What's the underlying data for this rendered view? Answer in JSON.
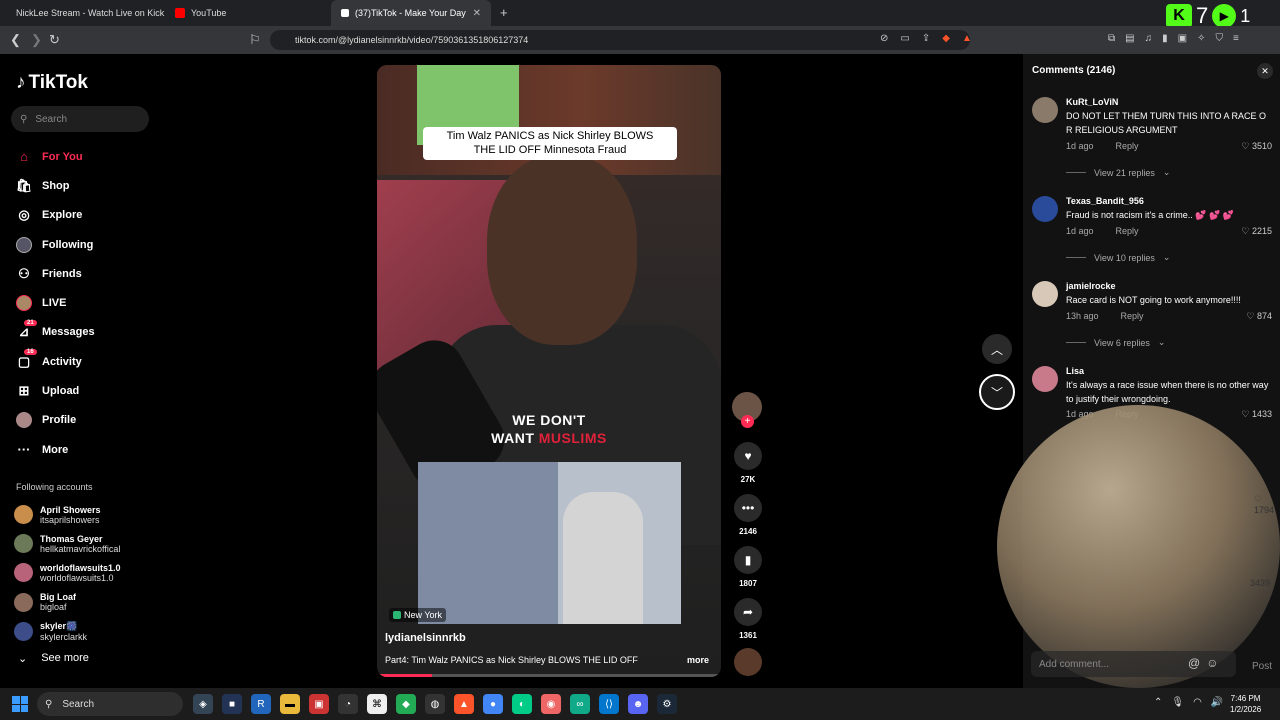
{
  "browser": {
    "tabs": [
      {
        "title": "NickLee Stream - Watch Live on Kick",
        "icon_color": "#53fc18"
      },
      {
        "title": "YouTube",
        "icon_color": "#ff0000"
      },
      {
        "title": "(37)TikTok - Make Your Day",
        "icon_color": "#ffffff"
      }
    ],
    "url": "tiktok.com/@lydianelsinnrkb/video/7590361351806127374",
    "kick_letter": "K",
    "kick_count": "7",
    "play_count": "1"
  },
  "sidebar": {
    "logo": "TikTok",
    "search_placeholder": "Search",
    "items": [
      {
        "label": "For You",
        "icon": "home-icon"
      },
      {
        "label": "Shop",
        "icon": "shop-icon"
      },
      {
        "label": "Explore",
        "icon": "compass-icon"
      },
      {
        "label": "Following",
        "icon": "following-icon"
      },
      {
        "label": "Friends",
        "icon": "friends-icon"
      },
      {
        "label": "LIVE",
        "icon": "live-icon"
      },
      {
        "label": "Messages",
        "icon": "message-icon",
        "badge": "21"
      },
      {
        "label": "Activity",
        "icon": "activity-icon",
        "badge": "16"
      },
      {
        "label": "Upload",
        "icon": "upload-icon"
      },
      {
        "label": "Profile",
        "icon": "profile-icon"
      },
      {
        "label": "More",
        "icon": "more-icon"
      }
    ],
    "following_title": "Following accounts",
    "following": [
      {
        "name": "April Showers",
        "handle": "itsaprilshowers",
        "color": "#c98e4b"
      },
      {
        "name": "Thomas Geyer",
        "handle": "hellkatmavrickoffical",
        "color": "#6d7a5a"
      },
      {
        "name": "worldoflawsuits1.0",
        "handle": "worldoflawsuits1.0",
        "color": "#b8637a"
      },
      {
        "name": "Big Loaf",
        "handle": "bigloaf",
        "color": "#8a6a5a"
      },
      {
        "name": "skyler🎆",
        "handle": "skylerclarkk",
        "color": "#3c4d8a"
      }
    ],
    "see_more": "See more"
  },
  "video": {
    "caption_line1": "Tim Walz PANICS as Nick Shirley BLOWS",
    "caption_line2": "THE LID OFF Minnesota Fraud",
    "overlay_white1": "WE DON'T",
    "overlay_white2": "WANT",
    "overlay_red": "MUSLIMS",
    "location": "New York",
    "username": "lydianelsinnrkb",
    "description": "Part4: Tim Walz PANICS as Nick Shirley BLOWS THE LID OFF",
    "more_label": "more",
    "progress": 0.16,
    "likes": "27K",
    "comments": "2146",
    "saves": "1807",
    "shares": "1361"
  },
  "comments_panel": {
    "title": "Comments (2146)",
    "reply_label": "Reply",
    "comments": [
      {
        "user": "KuRt_LoViN",
        "text": "DO NOT LET THEM TURN THIS INTO A RACE O R RELIGIOUS ARGUMENT",
        "time": "1d ago",
        "likes": "3510",
        "view_replies": "View 21 replies",
        "color": "#8a7a6a"
      },
      {
        "user": "Texas_Bandit_956",
        "text": "Fraud is not racism it's a crime.. 💕 💕 💕",
        "time": "1d ago",
        "likes": "2215",
        "view_replies": "View 10 replies",
        "color": "#2a4a9a"
      },
      {
        "user": "jamielrocke",
        "text": "Race card is NOT going to work anymore!!!!",
        "time": "13h ago",
        "likes": "874",
        "view_replies": "View 6 replies",
        "color": "#d8c8b8"
      },
      {
        "user": "Lisa",
        "text": "It's always a race issue when there is no other way to justify their wrongdoing.",
        "time": "1d ago",
        "likes": "1433",
        "view_replies": "",
        "color": "#c87a8a"
      }
    ],
    "hidden_likes_1": "1794",
    "hidden_likes_2": "3439",
    "add_placeholder": "Add comment...",
    "post_label": "Post"
  },
  "taskbar": {
    "search": "Search",
    "time": "7:46 PM",
    "date": "1/2/2026"
  }
}
